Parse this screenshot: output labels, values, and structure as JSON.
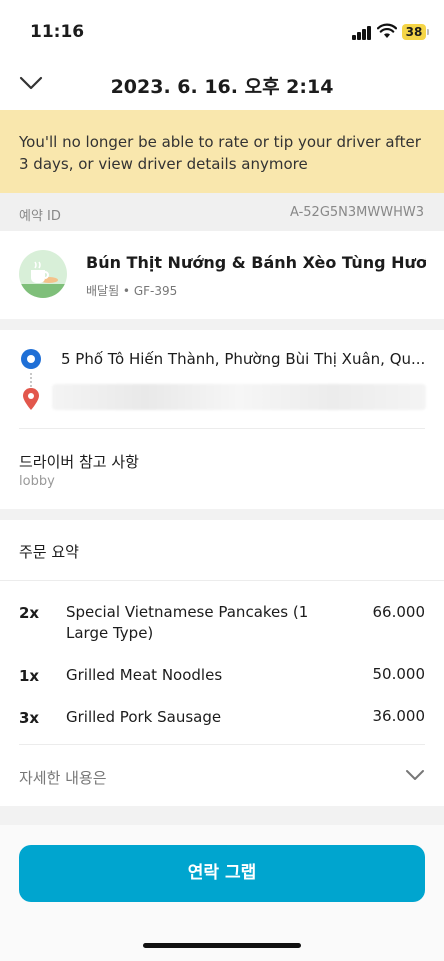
{
  "status_bar": {
    "time": "11:16",
    "battery": "38"
  },
  "header": {
    "title": "2023. 6. 16. 오후 2:14"
  },
  "banner": {
    "text": "You'll no longer be able to rate or tip your driver after 3 days, or view driver details anymore"
  },
  "booking": {
    "label": "예약 ID",
    "value": "A-52G5N3MWWHW3"
  },
  "merchant": {
    "name": "Bún Thịt Nướng & Bánh Xèo Tùng Hương",
    "subtitle": "배달됨 • GF-395"
  },
  "route": {
    "pickup": "5 Phố Tô Hiến Thành, Phường Bùi Thị Xuân, Qu..."
  },
  "driver_note": {
    "label": "드라이버 참고 사항",
    "value": "lobby"
  },
  "order_summary": {
    "title": "주문 요약",
    "items": [
      {
        "qty": "2x",
        "name": "Special Vietnamese Pancakes (1 Large Type)",
        "price": "66.000"
      },
      {
        "qty": "1x",
        "name": "Grilled Meat Noodles",
        "price": "50.000"
      },
      {
        "qty": "3x",
        "name": "Grilled Pork Sausage",
        "price": "36.000"
      }
    ],
    "details_label": "자세한 내용은"
  },
  "cta": {
    "label": "연락 그랩"
  },
  "colors": {
    "accent": "#00a5cf",
    "banner": "#f9e7ad",
    "pin_pickup": "#1f6fd6",
    "pin_dropoff": "#e2574c"
  }
}
